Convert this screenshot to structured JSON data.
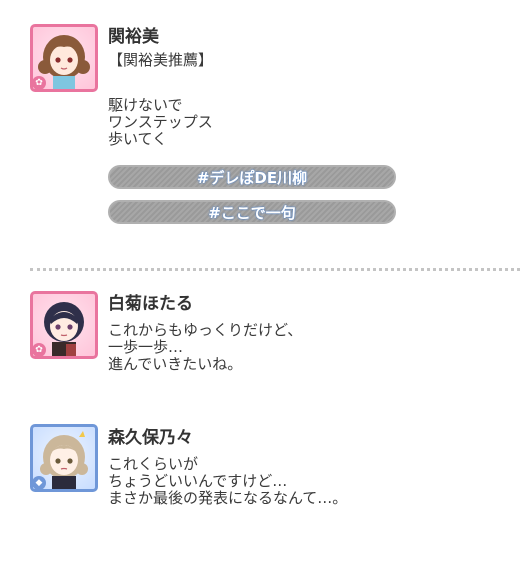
{
  "posts": [
    {
      "name": "関裕美",
      "lines": [
        "【関裕美推薦】",
        "",
        "駆けないで",
        "ワンステップス",
        "歩いてく"
      ],
      "tags": [
        "#デレぽDE川柳",
        "#ここで一句"
      ]
    },
    {
      "name": "白菊ほたる",
      "lines": [
        "これからもゆっくりだけど、",
        "一歩一歩…",
        "進んでいきたいね。"
      ]
    },
    {
      "name": "森久保乃々",
      "lines": [
        "これくらいが",
        "ちょうどいいんですけど…",
        "まさか最後の発表になるなんて…。"
      ]
    }
  ],
  "badges": {
    "cute_icon": "✿",
    "cool_icon": "◆"
  },
  "colors": {
    "cute_border": "#e9749e",
    "cool_border": "#6f97d8",
    "tag_button": "#a0a0a0",
    "tag_glow": "#5b8fd6"
  }
}
